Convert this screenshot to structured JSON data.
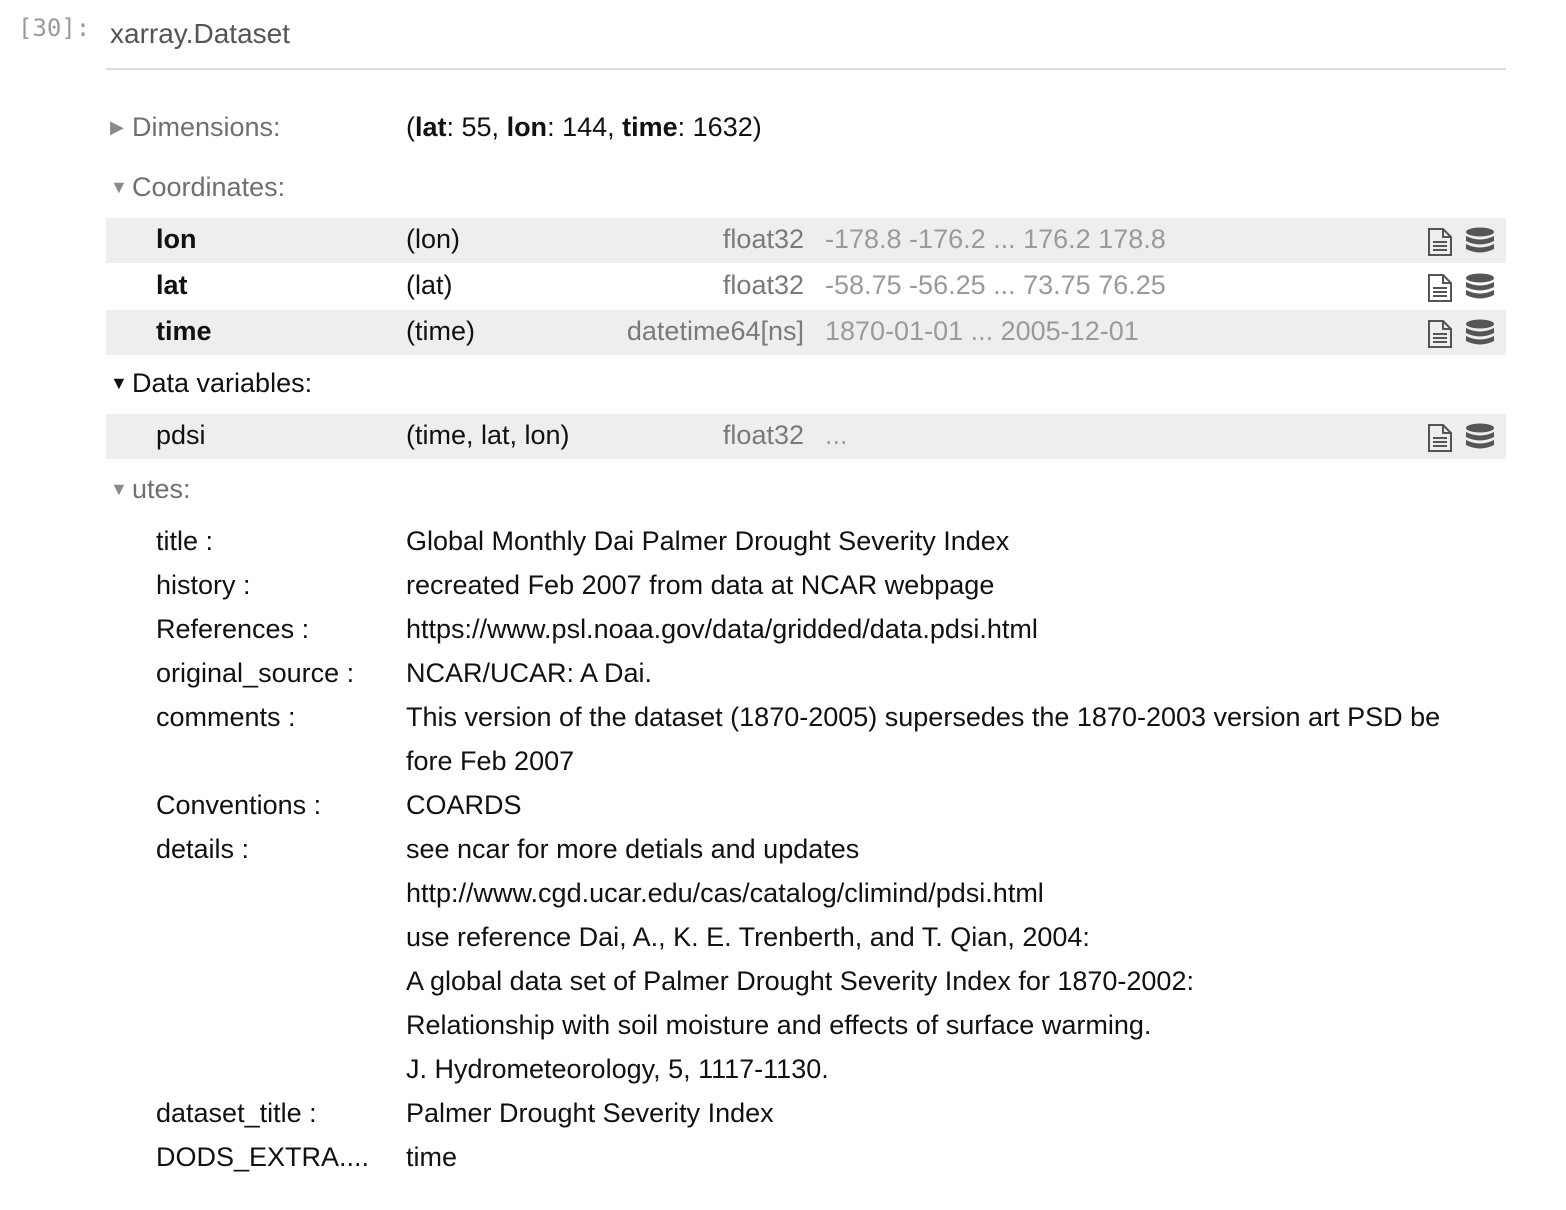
{
  "cell": {
    "prompt": "[30]:"
  },
  "header": {
    "title": "xarray.Dataset"
  },
  "sections": {
    "dimensions": "Dimensions:",
    "coordinates": "Coordinates:",
    "data_variables": "Data variables:",
    "attributes": "utes:"
  },
  "dimensions": {
    "open": "(",
    "lat_name": "lat",
    "lat_sep": ": 55, ",
    "lon_name": "lon",
    "lon_sep": ": 144, ",
    "time_name": "time",
    "time_sep": ": 1632)"
  },
  "coordinates": [
    {
      "name": "lon",
      "dims": "(lon)",
      "dtype": "float32",
      "preview": "-178.8 -176.2 ... 176.2 178.8"
    },
    {
      "name": "lat",
      "dims": "(lat)",
      "dtype": "float32",
      "preview": "-58.75 -56.25 ... 73.75 76.25"
    },
    {
      "name": "time",
      "dims": "(time)",
      "dtype": "datetime64[ns]",
      "preview": "1870-01-01 ... 2005-12-01"
    }
  ],
  "data_vars": [
    {
      "name": "pdsi",
      "dims": "(time, lat, lon)",
      "dtype": "float32",
      "preview": "..."
    }
  ],
  "attrs": {
    "title_key": "title :",
    "title_val": "Global Monthly Dai Palmer Drought Severity Index",
    "history_key": "history :",
    "history_val": "recreated Feb 2007 from data at NCAR webpage",
    "references_key": "References :",
    "references_val": "https://www.psl.noaa.gov/data/gridded/data.pdsi.html",
    "original_source_key": "original_source :",
    "original_source_val": "NCAR/UCAR: A Dai.",
    "comments_key": "comments :",
    "comments_val_1": "This version of the dataset (1870-2005) supersedes the 1870-2003 version art PSD be",
    "comments_val_2": "fore Feb 2007",
    "conventions_key": "Conventions :",
    "conventions_val": "COARDS",
    "details_key": "details :",
    "details_val_1": "see ncar for more detials and updates",
    "details_val_2": "http://www.cgd.ucar.edu/cas/catalog/climind/pdsi.html",
    "details_val_3": "use reference Dai, A., K. E. Trenberth, and T. Qian, 2004:",
    "details_val_4": "A global data set of Palmer Drought Severity Index for 1870-2002:",
    "details_val_5": "Relationship with soil moisture and effects of surface warming.",
    "details_val_6": "J. Hydrometeorology, 5, 1117-1130.",
    "dataset_title_key": "dataset_title :",
    "dataset_title_val": "Palmer Drought Severity Index",
    "dods_key": "DODS_EXTRA....",
    "dods_val": "time"
  },
  "icons": {
    "collapsed": "triangle-right-icon",
    "expanded": "triangle-down-icon",
    "attrs": "file-text-icon",
    "data": "database-icon"
  },
  "colors": {
    "row_shade": "#eeeeee",
    "muted": "#6f6f6f",
    "preview": "#9a9a9a"
  }
}
